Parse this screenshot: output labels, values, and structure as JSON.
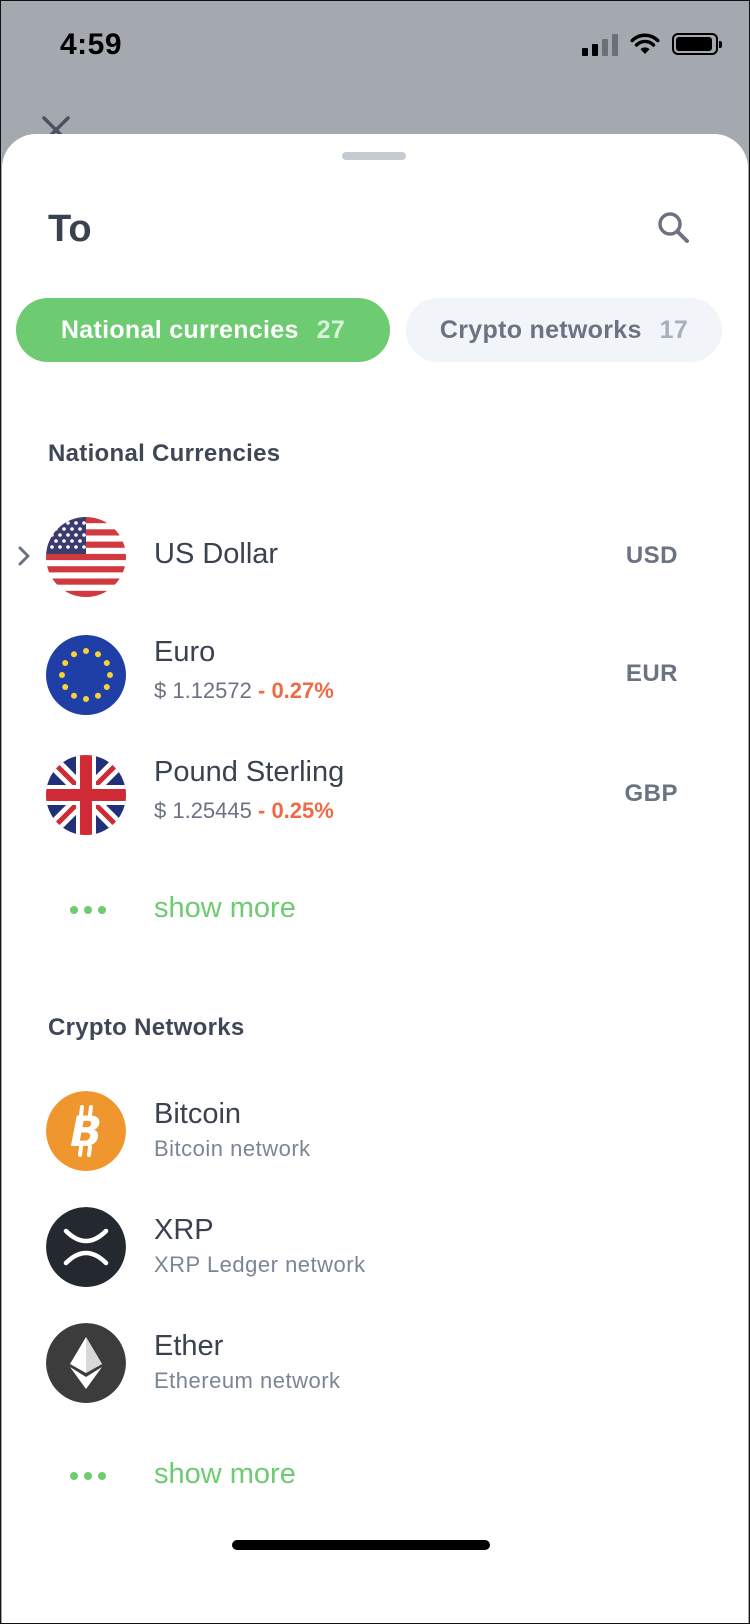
{
  "status_bar": {
    "time": "4:59"
  },
  "sheet": {
    "title": "To",
    "tabs": [
      {
        "label": "National currencies",
        "count": "27",
        "active": true
      },
      {
        "label": "Crypto networks",
        "count": "17",
        "active": false
      }
    ]
  },
  "national": {
    "section_title": "National Currencies",
    "items": [
      {
        "name": "US Dollar",
        "code": "USD",
        "price": "",
        "change": ""
      },
      {
        "name": "Euro",
        "code": "EUR",
        "price": "$ 1.12572",
        "change": "- 0.27%"
      },
      {
        "name": "Pound Sterling",
        "code": "GBP",
        "price": "$ 1.25445",
        "change": "- 0.25%"
      }
    ],
    "show_more": "show more"
  },
  "crypto": {
    "section_title": "Crypto Networks",
    "items": [
      {
        "name": "Bitcoin",
        "network": "Bitcoin network",
        "icon": "bitcoin-icon",
        "color": "#f0962f"
      },
      {
        "name": "XRP",
        "network": "XRP Ledger network",
        "icon": "xrp-icon",
        "color": "#23292f"
      },
      {
        "name": "Ether",
        "network": "Ethereum network",
        "icon": "ether-icon",
        "color": "#3c3c3d"
      }
    ],
    "show_more": "show more"
  },
  "colors": {
    "accent": "#6dcc71",
    "negative": "#ee6a44",
    "text": "#3a4250",
    "muted": "#6b7382"
  }
}
